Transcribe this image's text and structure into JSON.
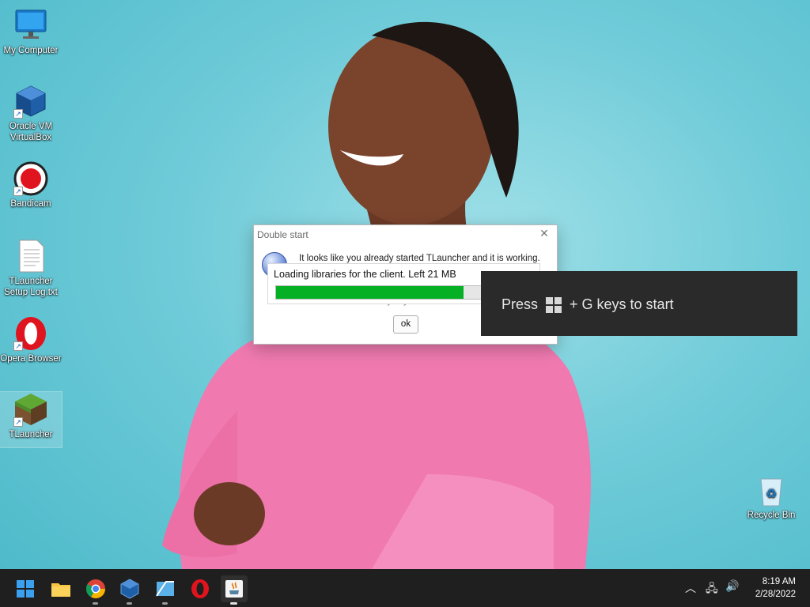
{
  "desktop": {
    "icons": [
      {
        "label": "My Computer"
      },
      {
        "label": "Oracle VM VirtualBox"
      },
      {
        "label": "Bandicam"
      },
      {
        "label": "TLauncher Setup Log.txt"
      },
      {
        "label": "Opera Browser"
      },
      {
        "label": "TLauncher"
      },
      {
        "label": "Recycle Bin"
      }
    ]
  },
  "dialog": {
    "title": "Double start",
    "message": "It looks like you already started TLauncher and it is working.",
    "message2": "Launch TLauncher anyway?",
    "ok_label": "ok",
    "icon": "info-icon"
  },
  "loader": {
    "text": "Loading libraries for the client. Left 21 MB",
    "progress": 0.91
  },
  "gamebar_hint": {
    "press": "Press",
    "suffix": "+ G keys to start",
    "icon": "windows-logo-icon"
  },
  "taskbar": {
    "items": [
      "start-icon",
      "file-explorer-icon",
      "chrome-icon",
      "virtualbox-icon",
      "network-app-icon",
      "opera-icon",
      "java-icon"
    ],
    "clock_time": "8:19 AM",
    "clock_date": "2/28/2022"
  },
  "colors": {
    "progress": "#06b025",
    "taskbar": "#1f1f1f",
    "hint_bg": "#2a2a2a"
  }
}
